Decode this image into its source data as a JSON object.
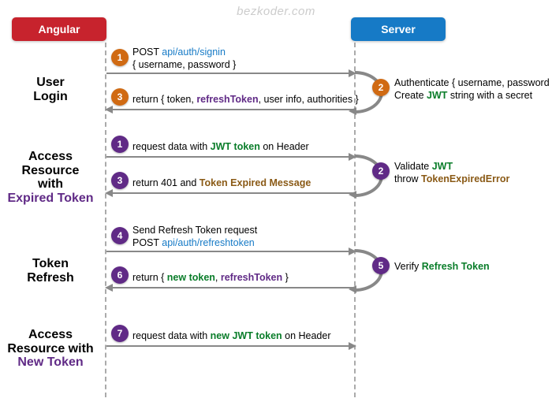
{
  "watermark": "bezkoder.com",
  "columns": {
    "client": "Angular",
    "server": "Server"
  },
  "sections": {
    "login": {
      "line1": "User",
      "line2": "Login",
      "em": ""
    },
    "expired": {
      "line1": "Access",
      "line2": "Resource",
      "line3": "with",
      "em": "Expired Token"
    },
    "refresh": {
      "line1": "Token",
      "line2": "Refresh",
      "em": ""
    },
    "newtok": {
      "line1": "Access",
      "line2": "Resource with",
      "em": "New Token"
    }
  },
  "steps": {
    "login": {
      "n1": "1",
      "l1a": "POST ",
      "l1b": "api/auth/signin",
      "l1c": "{ username, password }",
      "n2": "2",
      "l2a": "Authenticate { username, password }",
      "l2b_pre": "Create ",
      "l2b_jwt": "JWT",
      "l2b_post": " string with a secret",
      "n3": "3",
      "l3a": "return { token, ",
      "l3b": "refreshToken",
      "l3c": ", user info, authorities }"
    },
    "expired": {
      "n1": "1",
      "l1a": "request data with ",
      "l1b": "JWT token",
      "l1c": " on Header",
      "n2": "2",
      "l2a_pre": "Validate ",
      "l2a_jwt": "JWT",
      "l2b_pre": "throw ",
      "l2b_err": "TokenExpiredError",
      "n3": "3",
      "l3a": "return 401 and ",
      "l3b": "Token Expired Message"
    },
    "refresh": {
      "n4": "4",
      "l4a": "Send Refresh Token request",
      "l4b_pre": "POST ",
      "l4b_url": "api/auth/refreshtoken",
      "n5": "5",
      "l5a": "Verify ",
      "l5b": "Refresh Token",
      "n6": "6",
      "l6a": "return { ",
      "l6b": "new token",
      "l6c": ", ",
      "l6d": "refreshToken",
      "l6e": " }"
    },
    "newtok": {
      "n7": "7",
      "l7a": "request data with ",
      "l7b": "new JWT token",
      "l7c": " on Header"
    }
  },
  "chart_data": {
    "type": "sequence-diagram",
    "participants": [
      "Angular",
      "Server"
    ],
    "groups": [
      {
        "title": "User Login",
        "messages": [
          {
            "n": 1,
            "from": "Angular",
            "to": "Server",
            "text": "POST api/auth/signin { username, password }"
          },
          {
            "n": 2,
            "from": "Server",
            "to": "Server",
            "text": "Authenticate { username, password }; Create JWT string with a secret"
          },
          {
            "n": 3,
            "from": "Server",
            "to": "Angular",
            "text": "return { token, refreshToken, user info, authorities }"
          }
        ]
      },
      {
        "title": "Access Resource with Expired Token",
        "messages": [
          {
            "n": 1,
            "from": "Angular",
            "to": "Server",
            "text": "request data with JWT token on Header"
          },
          {
            "n": 2,
            "from": "Server",
            "to": "Server",
            "text": "Validate JWT; throw TokenExpiredError"
          },
          {
            "n": 3,
            "from": "Server",
            "to": "Angular",
            "text": "return 401 and Token Expired Message"
          }
        ]
      },
      {
        "title": "Token Refresh",
        "messages": [
          {
            "n": 4,
            "from": "Angular",
            "to": "Server",
            "text": "Send Refresh Token request; POST api/auth/refreshtoken"
          },
          {
            "n": 5,
            "from": "Server",
            "to": "Server",
            "text": "Verify Refresh Token"
          },
          {
            "n": 6,
            "from": "Server",
            "to": "Angular",
            "text": "return { new token, refreshToken }"
          }
        ]
      },
      {
        "title": "Access Resource with New Token",
        "messages": [
          {
            "n": 7,
            "from": "Angular",
            "to": "Server",
            "text": "request data with new JWT token on Header"
          }
        ]
      }
    ]
  }
}
